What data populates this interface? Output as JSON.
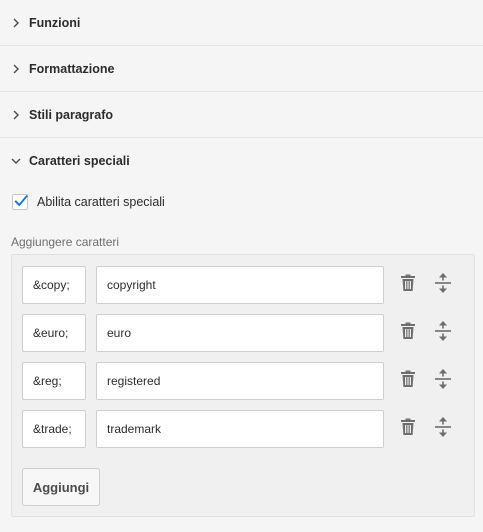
{
  "sections": [
    {
      "label": "Funzioni",
      "expanded": false
    },
    {
      "label": "Formattazione",
      "expanded": false
    },
    {
      "label": "Stili paragrafo",
      "expanded": false
    },
    {
      "label": "Caratteri speciali",
      "expanded": true
    }
  ],
  "special_chars": {
    "enable_label": "Abilita caratteri speciali",
    "enabled": true,
    "group_label": "Aggiungere caratteri",
    "items": [
      {
        "code": "&copy;",
        "name": "copyright"
      },
      {
        "code": "&euro;",
        "name": "euro"
      },
      {
        "code": "&reg;",
        "name": "registered"
      },
      {
        "code": "&trade;",
        "name": "trademark"
      }
    ],
    "add_label": "Aggiungi"
  },
  "colors": {
    "check": "#1473e6",
    "icon": "#6e6e6e"
  },
  "icons": {
    "collapsed": "chevron-right-icon",
    "expanded": "chevron-down-icon",
    "delete": "trash-icon",
    "reorder": "move-vertical-icon"
  }
}
